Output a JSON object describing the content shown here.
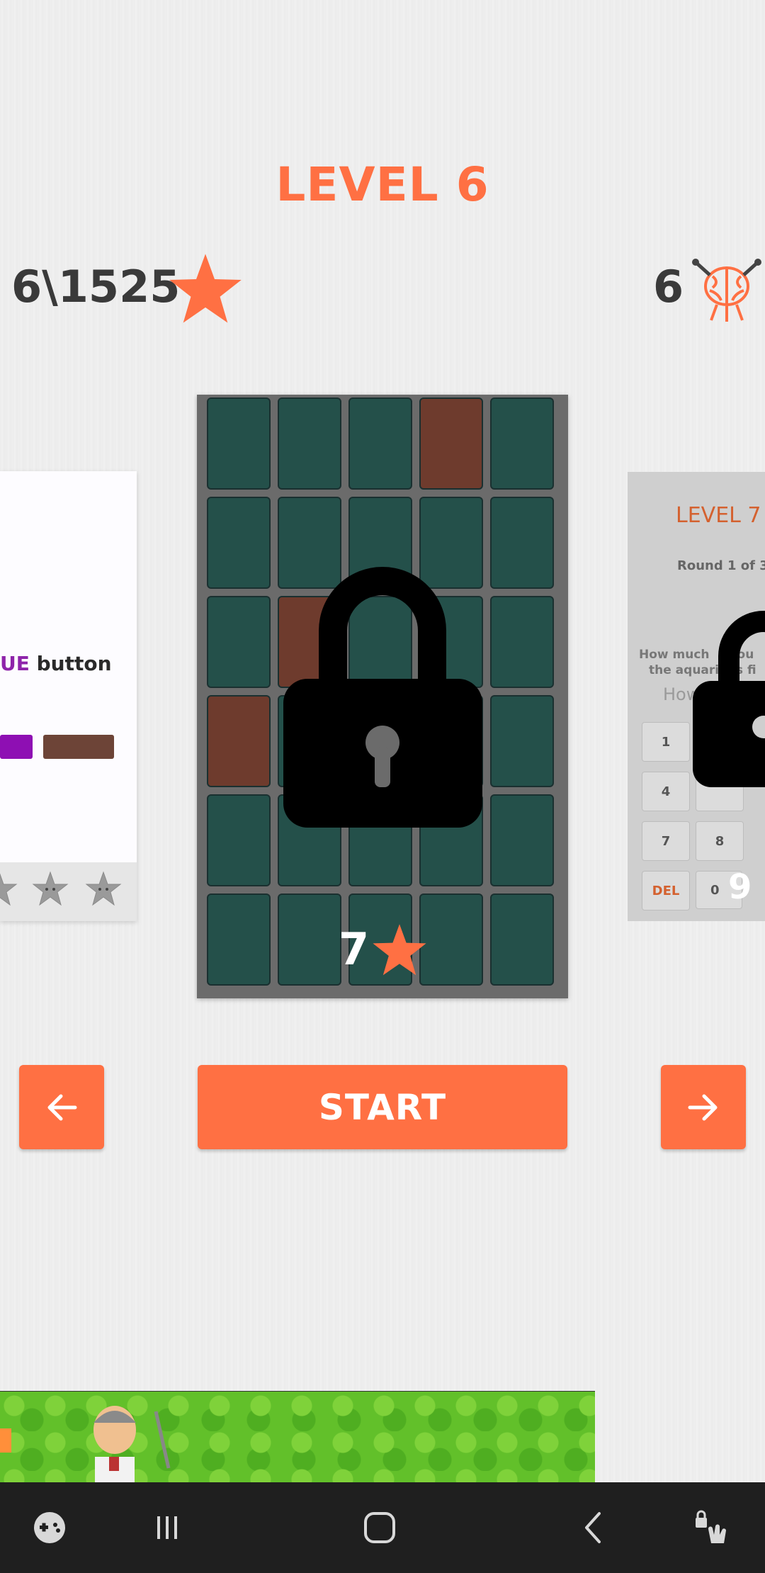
{
  "header": {
    "level_title": "LEVEL 6",
    "score": "6\\1525",
    "brain_count": "6"
  },
  "left_card": {
    "text_highlight": "UE",
    "text_rest": " button"
  },
  "center_card": {
    "star_count": "7",
    "grid": [
      [
        "teal",
        "teal",
        "teal",
        "brown",
        "teal"
      ],
      [
        "teal",
        "teal",
        "teal",
        "teal",
        "teal"
      ],
      [
        "teal",
        "brown",
        "teal",
        "teal",
        "teal"
      ],
      [
        "brown",
        "teal",
        "teal",
        "teal",
        "teal"
      ],
      [
        "teal",
        "teal",
        "teal",
        "teal",
        "teal"
      ],
      [
        "teal",
        "teal",
        "teal",
        "teal",
        "teal"
      ]
    ]
  },
  "right_card": {
    "level_title": "LEVEL 7",
    "round_text": "Round 1 of 3",
    "question_line1": "How much",
    "question_line2": "the aquari",
    "question_line1_tail": "you",
    "question_line2_tail": "is fi",
    "input_placeholder": "How",
    "keys": [
      "1",
      "4",
      "7",
      "8",
      "DEL",
      "0"
    ],
    "star_count": "9"
  },
  "buttons": {
    "start_label": "START"
  },
  "colors": {
    "accent": "#ff7043",
    "tile_teal": "#24504a",
    "tile_brown": "#6e3b2d"
  }
}
